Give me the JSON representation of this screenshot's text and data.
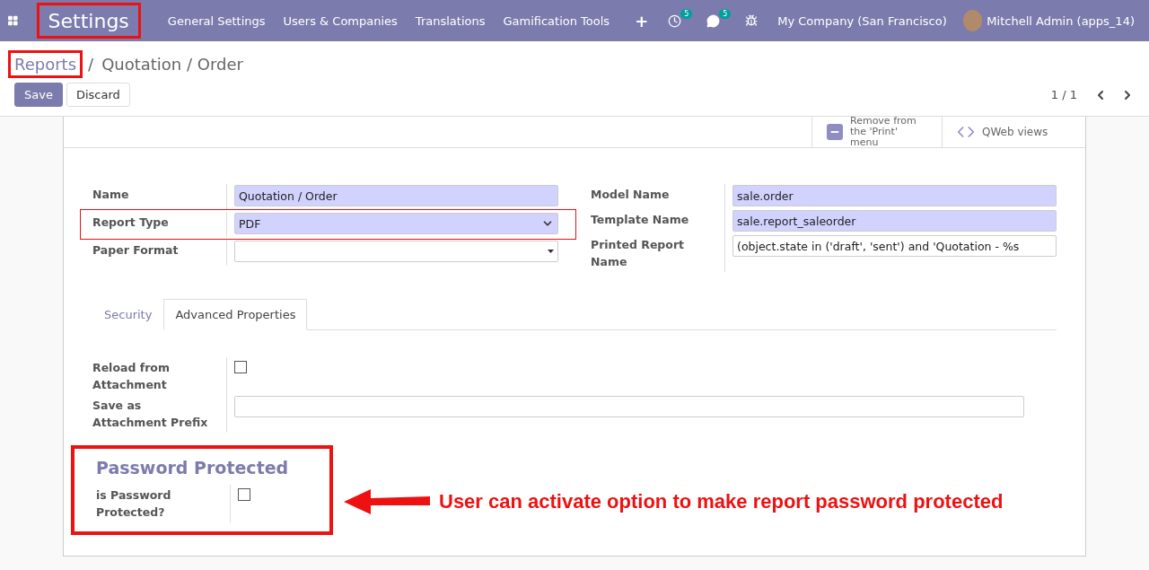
{
  "navbar": {
    "app_title": "Settings",
    "app_title_highlighted": true,
    "menu": [
      "General Settings",
      "Users & Companies",
      "Translations",
      "Gamification Tools"
    ],
    "add_icon": "+",
    "activity_count": "5",
    "message_count": "5",
    "company": "My Company (San Francisco)",
    "user": "Mitchell Admin (apps_14)"
  },
  "breadcrumb": [
    {
      "label": "Reports",
      "link": true,
      "highlighted": true
    },
    {
      "label": "Quotation / Order",
      "link": false,
      "highlighted": false
    }
  ],
  "breadcrumb_separator": "/",
  "buttons": [
    {
      "label": "Save",
      "primary": true
    },
    {
      "label": "Discard",
      "primary": false
    }
  ],
  "pager": "1 / 1",
  "button_box": [
    {
      "kind": "toggle",
      "label": "Remove from the 'Print' menu"
    },
    {
      "kind": "code",
      "label": "QWeb views"
    }
  ],
  "left_fields": [
    {
      "label": "Name",
      "kind": "char",
      "value": "Quotation / Order",
      "required": true,
      "highlighted": false
    },
    {
      "label": "Report Type",
      "kind": "select",
      "value": "PDF",
      "required": true,
      "highlighted": true
    },
    {
      "label": "Paper Format",
      "kind": "many2one",
      "required": false,
      "highlighted": false
    }
  ],
  "right_fields": [
    {
      "label": "Model Name",
      "kind": "char",
      "value": "sale.order",
      "required": true,
      "highlighted": false
    },
    {
      "label": "Template Name",
      "kind": "char",
      "value": "sale.report_saleorder",
      "required": true,
      "highlighted": false
    },
    {
      "label": "Printed Report Name",
      "kind": "char",
      "value": "(object.state in ('draft', 'sent') and 'Quotation - %s",
      "required": false,
      "highlighted": false
    }
  ],
  "tabs": [
    {
      "label": "Security",
      "selected": false
    },
    {
      "label": "Advanced Properties",
      "selected": true
    }
  ],
  "advanced_fields": [
    {
      "label": "Reload from Attachment",
      "kind": "checkbox",
      "checked": false
    },
    {
      "label": "Save as Attachment Prefix",
      "kind": "char",
      "required": false
    }
  ],
  "password_section": {
    "title": "Password Protected",
    "highlighted": true,
    "fields": [
      {
        "label": "is Password Protected?",
        "kind": "checkbox",
        "checked": false
      }
    ]
  },
  "annotation": {
    "text": "User can activate option to make report password protected"
  }
}
